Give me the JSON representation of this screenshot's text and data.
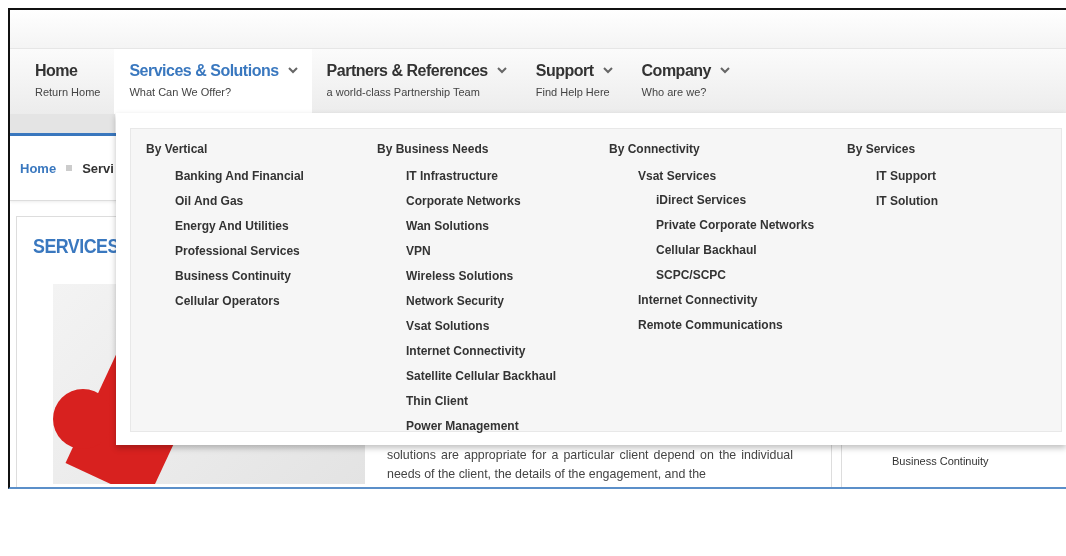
{
  "nav": {
    "items": [
      {
        "title": "Home",
        "subtitle": "Return Home",
        "has_menu": false,
        "selected": false
      },
      {
        "title": "Services & Solutions",
        "subtitle": "What Can We Offer?",
        "has_menu": true,
        "selected": true
      },
      {
        "title": "Partners & References",
        "subtitle": "a world-class Partnership Team",
        "has_menu": true,
        "selected": false
      },
      {
        "title": "Support",
        "subtitle": "Find Help Here",
        "has_menu": true,
        "selected": false
      },
      {
        "title": "Company",
        "subtitle": "Who are we?",
        "has_menu": true,
        "selected": false
      }
    ]
  },
  "menu": {
    "columns": [
      {
        "heading": "By Vertical",
        "items": [
          {
            "label": "Banking And Financial"
          },
          {
            "label": "Oil And Gas"
          },
          {
            "label": "Energy And Utilities"
          },
          {
            "label": "Professional Services"
          },
          {
            "label": "Business Continuity"
          },
          {
            "label": "Cellular Operators"
          }
        ]
      },
      {
        "heading": "By Business Needs",
        "items": [
          {
            "label": "IT Infrastructure"
          },
          {
            "label": "Corporate Networks"
          },
          {
            "label": "Wan Solutions"
          },
          {
            "label": "VPN"
          },
          {
            "label": "Wireless Solutions"
          },
          {
            "label": "Network Security"
          },
          {
            "label": "Vsat Solutions"
          },
          {
            "label": "Internet Connectivity"
          },
          {
            "label": "Satellite Cellular Backhaul"
          },
          {
            "label": "Thin Client"
          },
          {
            "label": "Power Management"
          }
        ]
      },
      {
        "heading": "By Connectivity",
        "items": [
          {
            "label": "Vsat Services",
            "children": [
              {
                "label": "iDirect Services"
              },
              {
                "label": "Private Corporate Networks"
              },
              {
                "label": "Cellular Backhaul"
              },
              {
                "label": "SCPC/SCPC"
              }
            ]
          },
          {
            "label": "Internet Connectivity"
          },
          {
            "label": "Remote Communications"
          }
        ]
      },
      {
        "heading": "By Services",
        "items": [
          {
            "label": "IT Support"
          },
          {
            "label": "IT Solution"
          }
        ]
      }
    ]
  },
  "breadcrumb": [
    "Home",
    "Servi"
  ],
  "content": {
    "title": "SERVICES",
    "paragraph": "solutions are appropriate for a particular client depend on the individual needs of the client, the details of the engagement, and the"
  },
  "sidebar": {
    "items": [
      "Business Continuity"
    ]
  }
}
